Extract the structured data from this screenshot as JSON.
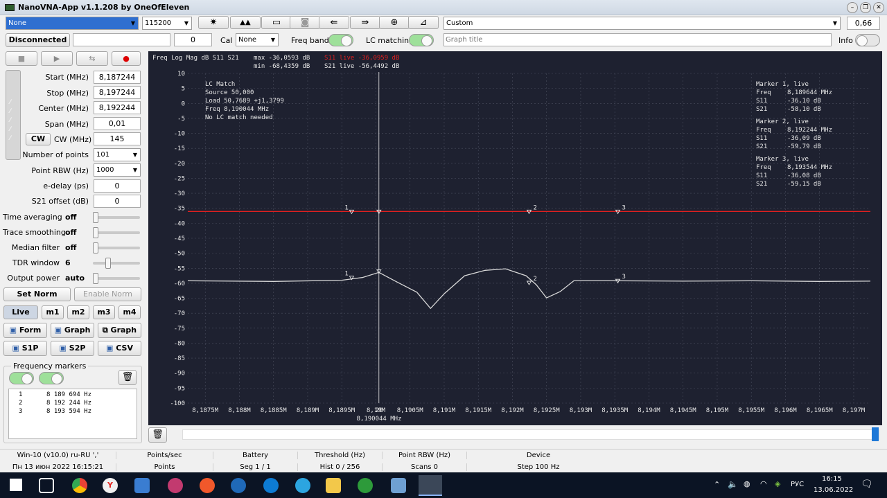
{
  "window": {
    "title": "NanoVNA-App v1.1.208 by OneOfEleven"
  },
  "toolbar": {
    "port": "None",
    "baud": "115200",
    "calibration_preset": "Custom",
    "top_right_value": "0,66",
    "connection_button": "Disconnected",
    "connection_info": "",
    "counter": "0",
    "cal_label": "Cal",
    "cal_value": "None",
    "freq_bands_label": "Freq bands",
    "lc_matching_label": "LC matching",
    "graph_title_placeholder": "Graph title",
    "info_label": "Info"
  },
  "left_panel": {
    "fields": [
      {
        "label": "Start (MHz)",
        "value": "8,187244"
      },
      {
        "label": "Stop (MHz)",
        "value": "8,197244"
      },
      {
        "label": "Center (MHz)",
        "value": "8,192244"
      },
      {
        "label": "Span (MHz)",
        "value": "0,01"
      },
      {
        "label": "CW (MHz)",
        "value": "145"
      }
    ],
    "cw_button": "CW",
    "number_of_points_label": "Number of points",
    "number_of_points": "101",
    "point_rbw_label": "Point RBW (Hz)",
    "point_rbw": "1000",
    "e_delay_label": "e-delay (ps)",
    "e_delay": "0",
    "s21_offset_label": "S21 offset (dB)",
    "s21_offset": "0",
    "sliders": [
      {
        "label": "Time averaging",
        "value": "off",
        "level": 0
      },
      {
        "label": "Trace smoothing",
        "value": "off",
        "level": 0
      },
      {
        "label": "Median filter",
        "value": "off",
        "level": 0
      },
      {
        "label": "TDR window",
        "value": "6",
        "level": 0.3
      },
      {
        "label": "Output power",
        "value": "auto",
        "level": 0
      }
    ],
    "set_norm": "Set Norm",
    "enable_norm": "Enable Norm",
    "mode_buttons": [
      "Live",
      "m1",
      "m2",
      "m3",
      "m4"
    ],
    "save_buttons": [
      "Form",
      "Graph",
      "Graph",
      "S1P",
      "S2P",
      "CSV"
    ],
    "freq_markers_title": "Frequency markers",
    "markers": [
      {
        "n": "1",
        "freq": "8 189 694 Hz"
      },
      {
        "n": "2",
        "freq": "8 192 244 Hz"
      },
      {
        "n": "3",
        "freq": "8 193 594 Hz"
      }
    ]
  },
  "plot": {
    "header": {
      "mode": "Freq Log Mag dB S11 S21",
      "max": "max -36,0593 dB",
      "min": "min -68,4359 dB",
      "s11_live": "S11 live -36,0959 dB",
      "s21_live": "S21 live -56,4492 dB"
    },
    "lc_match": {
      "title": "LC Match",
      "source": "Source 50,000",
      "load": "Load   50,7689 +j1,3799",
      "freq": "Freq   8,190044 MHz",
      "note": "No LC match needed"
    },
    "marker_info": [
      {
        "title": "Marker 1, live",
        "freq": "8,189644 MHz",
        "s11": "-36,10 dB",
        "s21": "-58,10 dB"
      },
      {
        "title": "Marker 2, live",
        "freq": "8,192244 MHz",
        "s11": "-36,09 dB",
        "s21": "-59,79 dB"
      },
      {
        "title": "Marker 3, live",
        "freq": "8,193544 MHz",
        "s11": "-36,08 dB",
        "s21": "-59,15 dB"
      }
    ],
    "cursor_index": "29",
    "cursor_freq": "8,190044 MHz",
    "colors": {
      "background": "#1e2130",
      "s11": "#e02020",
      "s21": "#d8d8d8",
      "grid": "#4a4e5e"
    }
  },
  "chart_data": {
    "type": "line",
    "xlim": [
      8.187244,
      8.197244
    ],
    "ylim": [
      -100,
      10
    ],
    "x_ticks": [
      "8,1875M",
      "8,188M",
      "8,1885M",
      "8,189M",
      "8,1895M",
      "8,19M",
      "8,1905M",
      "8,191M",
      "8,1915M",
      "8,192M",
      "8,1925M",
      "8,193M",
      "8,1935M",
      "8,194M",
      "8,1945M",
      "8,195M",
      "8,1955M",
      "8,196M",
      "8,1965M",
      "8,197M"
    ],
    "y_ticks": [
      "10",
      "5",
      "0",
      "-5",
      "-10",
      "-15",
      "-20",
      "-25",
      "-30",
      "-35",
      "-40",
      "-45",
      "-50",
      "-55",
      "-60",
      "-65",
      "-70",
      "-75",
      "-80",
      "-85",
      "-90",
      "-95",
      "-100"
    ],
    "series": [
      {
        "name": "S11",
        "x": [
          8.187244,
          8.197244
        ],
        "y": [
          -36.06,
          -36.06
        ]
      },
      {
        "name": "S21",
        "x": [
          8.187244,
          8.1885,
          8.1895,
          8.1898,
          8.190044,
          8.1903,
          8.1906,
          8.1908,
          8.191,
          8.1913,
          8.1916,
          8.1919,
          8.1922,
          8.19235,
          8.1925,
          8.1927,
          8.1929,
          8.1935,
          8.1945,
          8.1955,
          8.1965,
          8.197244
        ],
        "y": [
          -59.2,
          -59.4,
          -59.0,
          -58.1,
          -56.4,
          -59.5,
          -63.0,
          -68.4,
          -63.5,
          -57.5,
          -55.7,
          -55.2,
          -57.5,
          -60.5,
          -64.9,
          -62.8,
          -59.2,
          -59.2,
          -59.3,
          -59.2,
          -59.4,
          -59.3
        ]
      }
    ]
  },
  "statusbar": {
    "row1": [
      "Win-10 (v10.0) ru-RU ','",
      "Points/sec",
      "Battery",
      "Threshold (Hz)",
      "Point RBW (Hz)",
      "Device"
    ],
    "row2": [
      "Пн 13 июн 2022 16:15:21",
      "Points",
      "Seg 1 / 1",
      "Hist 0 / 256",
      "Scans 0",
      "Step 100 Hz"
    ]
  },
  "taskbar": {
    "lang": "РУС",
    "time": "16:15",
    "date": "13.06.2022"
  }
}
